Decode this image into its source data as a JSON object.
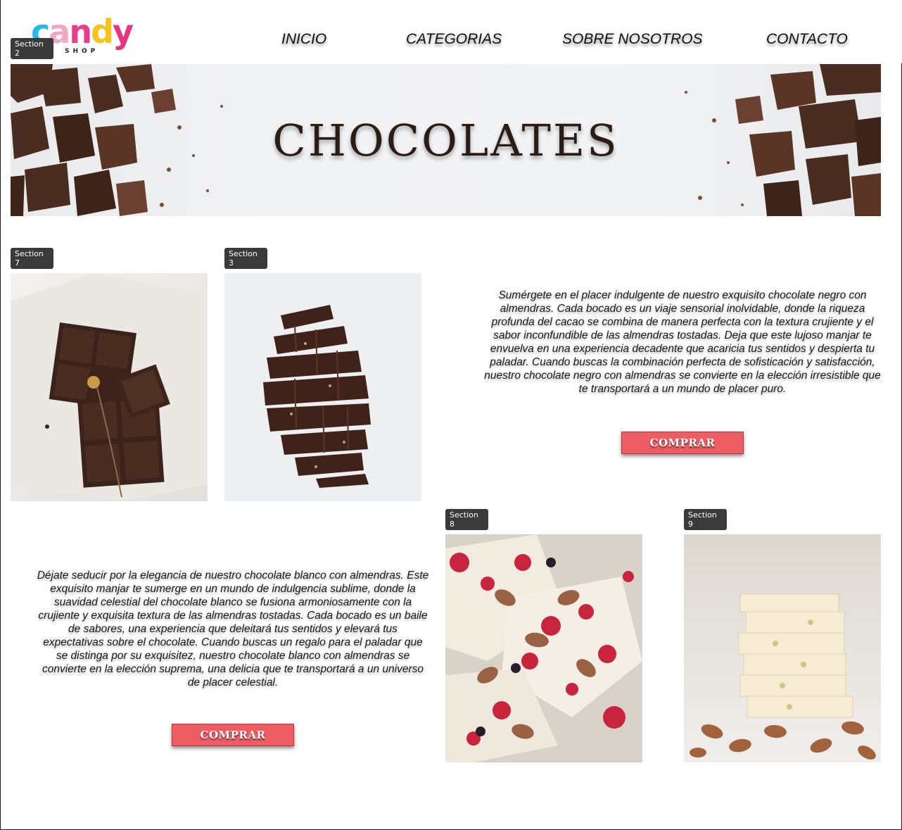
{
  "brand": {
    "logo_letters": [
      "c",
      "a",
      "n",
      "d",
      "y"
    ],
    "logo_colors": [
      "#27b8e8",
      "#f4a7c4",
      "#e83c8d",
      "#f7c21b",
      "#e8347f"
    ],
    "logo_sub": "SHOP"
  },
  "nav": {
    "items": [
      "INICIO",
      "CATEGORIAS",
      "SOBRE NOSOTROS",
      "CONTACTO"
    ]
  },
  "section_tags": {
    "header": "Section 2",
    "photo_dark_1": "Section 7",
    "photo_dark_2": "Section 3",
    "photo_white_1": "Section 8",
    "photo_white_2": "Section 9"
  },
  "hero": {
    "title": "CHOCOLATES"
  },
  "products": {
    "dark": {
      "description": "Sumérgete en el placer indulgente de nuestro exquisito chocolate negro con almendras. Cada bocado es un viaje sensorial inolvidable, donde la riqueza profunda del cacao se combina de manera perfecta con la textura crujiente y el sabor inconfundible de las almendras tostadas. Deja que este lujoso manjar te envuelva en una experiencia decadente que acaricia tus sentidos y despierta tu paladar. Cuando buscas la combinación perfecta de sofisticación y satisfacción, nuestro chocolate negro con almendras se convierte en la elección irresistible que te transportará a un mundo de placer puro.",
      "buy_label": "COMPRAR"
    },
    "white": {
      "description": "Déjate seducir por la elegancia de nuestro chocolate blanco con almendras. Este exquisito manjar te sumerge en un mundo de indulgencia sublime, donde la suavidad celestial del chocolate blanco se fusiona armoniosamente con la crujiente y exquisita textura de las almendras tostadas. Cada bocado es un baile de sabores, una experiencia que deleitará tus sentidos y elevará tus expectativas sobre el chocolate. Cuando buscas un regalo para el paladar que se distinga por su exquisitez, nuestro chocolate blanco con almendras se convierte en la elección suprema, una delicia que te transportará a un universo de placer celestial.",
      "buy_label": "COMPRAR"
    }
  },
  "colors": {
    "button": "#ef5d64",
    "tag_bg": "#3a3a3a",
    "chocolate": "#4a2a1e"
  }
}
